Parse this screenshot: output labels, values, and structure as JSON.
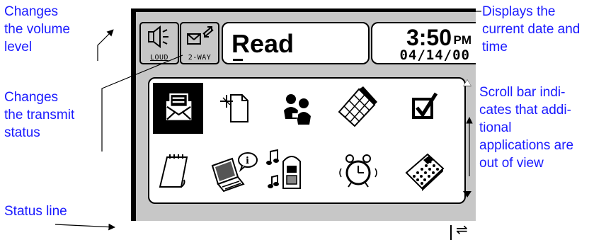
{
  "callouts": {
    "volume": "Changes\nthe volume\nlevel",
    "transmit": "Changes\nthe transmit\nstatus",
    "status_line": "Status line",
    "datetime": "Displays the\ncurrent date and\ntime",
    "scroll": "Scroll bar indi-\ncates that addi-\ntional\napplications are\nout of view"
  },
  "toolbar": {
    "loud_label": "LOUD",
    "loud_icon": "speaker-icon",
    "twoway_label": "2-WAY",
    "twoway_icon": "two-way-transmit-icon",
    "message_title": "Read"
  },
  "clock": {
    "time": "3:50",
    "ampm": "PM",
    "date": "04/14/00"
  },
  "apps": [
    {
      "icon": "mail-envelope-icon",
      "selected": true
    },
    {
      "icon": "new-document-icon",
      "selected": false
    },
    {
      "icon": "contacts-people-icon",
      "selected": false
    },
    {
      "icon": "calendar-icon",
      "selected": false
    },
    {
      "icon": "checkbox-tasks-icon",
      "selected": false
    },
    {
      "icon": "notepad-icon",
      "selected": false
    },
    {
      "icon": "laptop-info-icon",
      "selected": false
    },
    {
      "icon": "music-jukebox-icon",
      "selected": false
    },
    {
      "icon": "alarm-clock-icon",
      "selected": false
    },
    {
      "icon": "calculator-icon",
      "selected": false
    }
  ],
  "status_bar": {
    "transfer_icon": "transfer-arrows-icon",
    "transfer_glyph": "⇌"
  },
  "colors": {
    "callout_text": "#1a1aff",
    "device_gray": "#c7c7c7",
    "selected_app": "#000000"
  }
}
